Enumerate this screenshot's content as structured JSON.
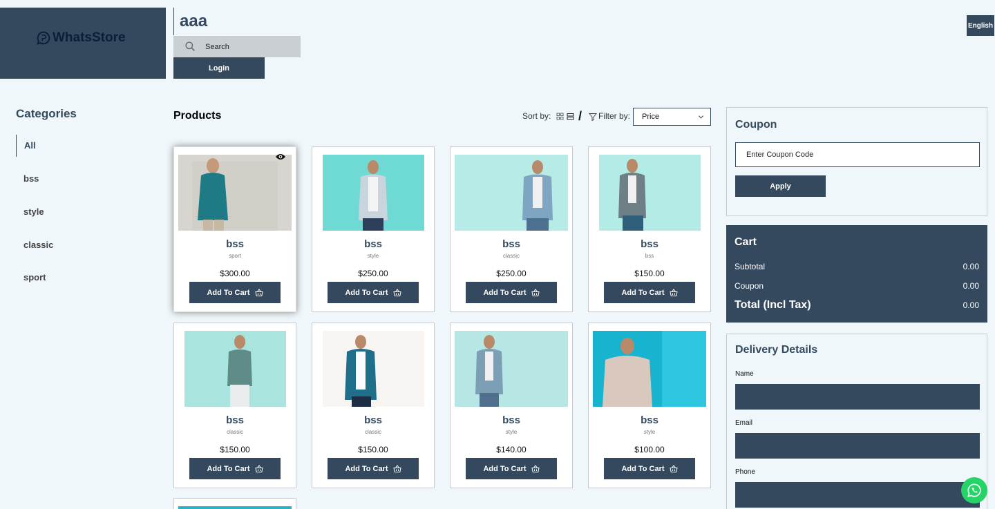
{
  "header": {
    "logo_text": "WhatsStore",
    "store_name": "aaa",
    "search_placeholder": "Search",
    "login_label": "Login",
    "language_label": "English"
  },
  "categories": {
    "title": "Categories",
    "items": [
      "All",
      "bss",
      "style",
      "classic",
      "sport"
    ],
    "active": "All"
  },
  "products_section": {
    "title": "Products",
    "sort_label": "Sort by:",
    "filter_label": "Filter by:",
    "filter_value": "Price"
  },
  "products": [
    {
      "name": "bss",
      "category": "sport",
      "price": "$300.00",
      "button": "Add To Cart"
    },
    {
      "name": "bss",
      "category": "style",
      "price": "$250.00",
      "button": "Add To Cart"
    },
    {
      "name": "bss",
      "category": "classic",
      "price": "$250.00",
      "button": "Add To Cart"
    },
    {
      "name": "bss",
      "category": "bss",
      "price": "$150.00",
      "button": "Add To Cart"
    },
    {
      "name": "bss",
      "category": "classic",
      "price": "$150.00",
      "button": "Add To Cart"
    },
    {
      "name": "bss",
      "category": "classic",
      "price": "$150.00",
      "button": "Add To Cart"
    },
    {
      "name": "bss",
      "category": "style",
      "price": "$140.00",
      "button": "Add To Cart"
    },
    {
      "name": "bss",
      "category": "style",
      "price": "$100.00",
      "button": "Add To Cart"
    }
  ],
  "coupon": {
    "title": "Coupon",
    "placeholder": "Enter Coupon Code",
    "apply_label": "Apply"
  },
  "cart": {
    "title": "Cart",
    "subtotal_label": "Subtotal",
    "subtotal_value": "0.00",
    "coupon_label": "Coupon",
    "coupon_value": "0.00",
    "total_label": "Total (Incl Tax)",
    "total_value": "0.00"
  },
  "delivery": {
    "title": "Delivery Details",
    "name_label": "Name",
    "email_label": "Email",
    "phone_label": "Phone"
  },
  "colors": {
    "primary": "#34495e",
    "background": "#eff7fa",
    "whatsapp": "#25d366"
  }
}
